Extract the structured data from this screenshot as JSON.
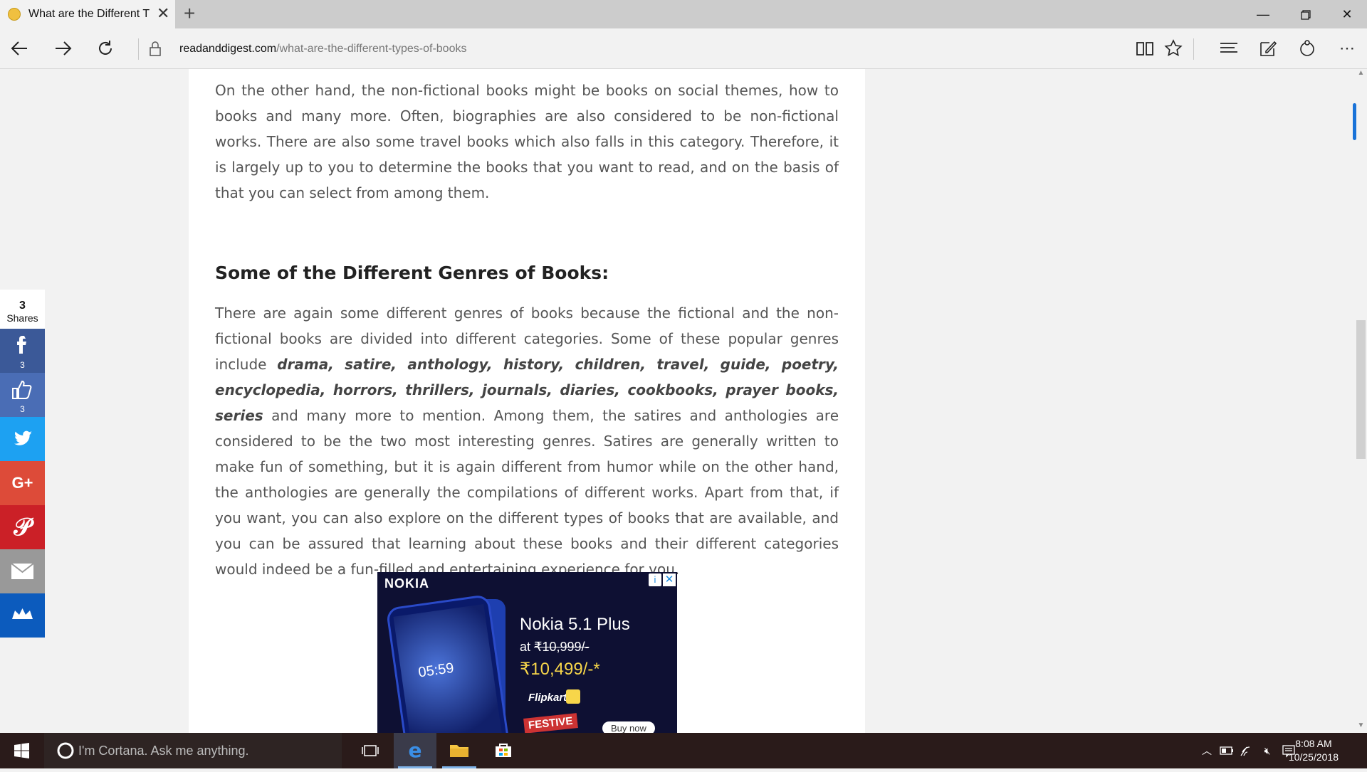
{
  "browser": {
    "tab_title": "What are the Different T",
    "url_host": "readanddigest.com",
    "url_path": "/what-are-the-different-types-of-books"
  },
  "article": {
    "para1": "On the other hand, the non-fictional books might be books on social themes, how to books and many more. Often, biographies are also considered to be non-fictional works. There are also some travel books which also falls in this category. Therefore, it is largely up to you to determine the books that you want to read, and on the basis of that you can select from among them.",
    "heading": "Some of the Different Genres of Books:",
    "para2_start": "There are again some different genres of books because the fictional and the non-fictional books are divided into different categories. Some of these popular genres include ",
    "para2_genres": "drama, satire, anthology, history, children, travel, guide, poetry, encyclopedia, horrors, thrillers, journals, diaries, cookbooks, prayer books, series",
    "para2_end": " and many more to mention.  Among them, the satires and anthologies are considered to be the two most interesting genres. Satires are generally written to make fun of something, but it is again different from humor while on the other hand, the anthologies are generally the compilations of different works. Apart from that, if you want, you can also explore on the different types of books that are available, and you can be assured that learning about these books and their different categories would indeed be a fun-filled and entertaining experience for you."
  },
  "ad": {
    "brand": "NOKIA",
    "info": "i",
    "close": "✕",
    "time": "05:59",
    "model": "Nokia 5.1 Plus",
    "at": "at",
    "old_price": "₹10,999/-",
    "new_price": "₹10,499/-*",
    "store": "Flipkart",
    "festive": "FESTIVE",
    "buy": "Buy now"
  },
  "share": {
    "count": "3",
    "label": "Shares",
    "facebook_count": "3",
    "like_count": "3",
    "buttons": [
      {
        "name": "facebook",
        "color": "#3b5998"
      },
      {
        "name": "like",
        "color": "#4a6db5"
      },
      {
        "name": "twitter",
        "color": "#1da1f2"
      },
      {
        "name": "google-plus",
        "color": "#dd4b39"
      },
      {
        "name": "pinterest",
        "color": "#cb2027"
      },
      {
        "name": "email",
        "color": "#999999"
      },
      {
        "name": "sumo",
        "color": "#0c5bbd"
      }
    ]
  },
  "taskbar": {
    "cortana": "I'm Cortana. Ask me anything.",
    "time": "8:08 AM",
    "date": "10/25/2018"
  }
}
